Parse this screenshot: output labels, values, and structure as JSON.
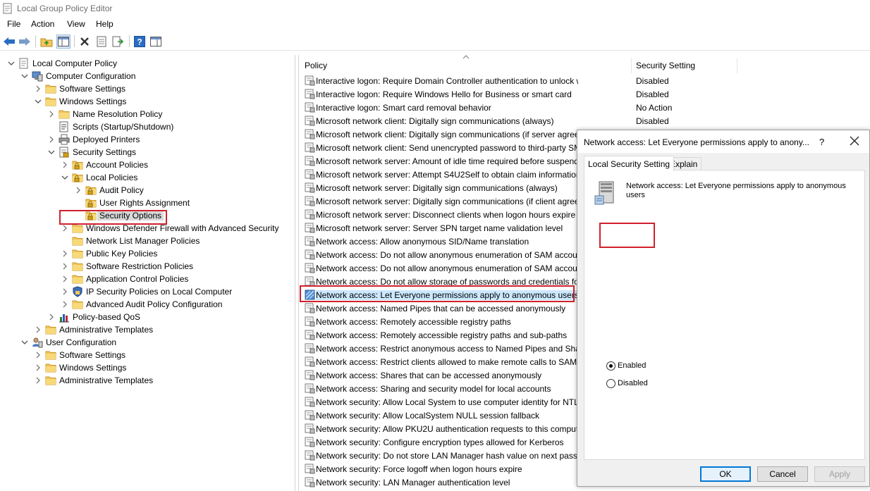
{
  "window": {
    "title": "Local Group Policy Editor"
  },
  "menu": [
    "File",
    "Action",
    "View",
    "Help"
  ],
  "tree": [
    {
      "label": "Local Computer Policy",
      "icon": "policy-doc-icon",
      "expanded": true
    },
    {
      "label": "Computer Configuration",
      "icon": "computer-icon",
      "expanded": true
    },
    {
      "label": "Software Settings",
      "icon": "folder-icon",
      "expanded": false
    },
    {
      "label": "Windows Settings",
      "icon": "folder-icon",
      "expanded": true
    },
    {
      "label": "Name Resolution Policy",
      "icon": "folder-icon",
      "expanded": false
    },
    {
      "label": "Scripts (Startup/Shutdown)",
      "icon": "script-icon",
      "expanded": null
    },
    {
      "label": "Deployed Printers",
      "icon": "printer-icon",
      "expanded": false
    },
    {
      "label": "Security Settings",
      "icon": "security-settings-icon",
      "expanded": true
    },
    {
      "label": "Account Policies",
      "icon": "locked-folder-icon",
      "expanded": false
    },
    {
      "label": "Local Policies",
      "icon": "locked-folder-icon",
      "expanded": true
    },
    {
      "label": "Audit Policy",
      "icon": "locked-folder-icon",
      "expanded": false
    },
    {
      "label": "User Rights Assignment",
      "icon": "locked-folder-icon",
      "expanded": null
    },
    {
      "label": "Security Options",
      "icon": "locked-folder-icon",
      "expanded": null,
      "selected": true
    },
    {
      "label": "Windows Defender Firewall with Advanced Security",
      "icon": "folder-icon",
      "expanded": false
    },
    {
      "label": "Network List Manager Policies",
      "icon": "folder-icon",
      "expanded": null
    },
    {
      "label": "Public Key Policies",
      "icon": "folder-icon",
      "expanded": false
    },
    {
      "label": "Software Restriction Policies",
      "icon": "folder-icon",
      "expanded": false
    },
    {
      "label": "Application Control Policies",
      "icon": "folder-icon",
      "expanded": false
    },
    {
      "label": "IP Security Policies on Local Computer",
      "icon": "ip-security-icon",
      "expanded": false
    },
    {
      "label": "Advanced Audit Policy Configuration",
      "icon": "folder-icon",
      "expanded": false
    },
    {
      "label": "Policy-based QoS",
      "icon": "qos-chart-icon",
      "expanded": false
    },
    {
      "label": "Administrative Templates",
      "icon": "folder-icon",
      "expanded": false
    },
    {
      "label": "User Configuration",
      "icon": "user-icon",
      "expanded": true
    },
    {
      "label": "Software Settings",
      "icon": "folder-icon",
      "expanded": false
    },
    {
      "label": "Windows Settings",
      "icon": "folder-icon",
      "expanded": false
    },
    {
      "label": "Administrative Templates",
      "icon": "folder-icon",
      "expanded": false
    }
  ],
  "list": {
    "columns": {
      "policy": "Policy",
      "setting": "Security Setting"
    },
    "rows": [
      {
        "policy": "Interactive logon: Require Domain Controller authentication to unlock workstation",
        "setting": "Disabled"
      },
      {
        "policy": "Interactive logon: Require Windows Hello for Business or smart card",
        "setting": "Disabled"
      },
      {
        "policy": "Interactive logon: Smart card removal behavior",
        "setting": "No Action"
      },
      {
        "policy": "Microsoft network client: Digitally sign communications (always)",
        "setting": "Disabled"
      },
      {
        "policy": "Microsoft network client: Digitally sign communications (if server agree",
        "setting": ""
      },
      {
        "policy": "Microsoft network client: Send unencrypted password to third-party SM",
        "setting": ""
      },
      {
        "policy": "Microsoft network server: Amount of idle time required before suspend",
        "setting": ""
      },
      {
        "policy": "Microsoft network server: Attempt S4U2Self to obtain claim information",
        "setting": ""
      },
      {
        "policy": "Microsoft network server: Digitally sign communications (always)",
        "setting": ""
      },
      {
        "policy": "Microsoft network server: Digitally sign communications (if client agree",
        "setting": ""
      },
      {
        "policy": "Microsoft network server: Disconnect clients when logon hours expire",
        "setting": ""
      },
      {
        "policy": "Microsoft network server: Server SPN target name validation level",
        "setting": ""
      },
      {
        "policy": "Network access: Allow anonymous SID/Name translation",
        "setting": ""
      },
      {
        "policy": "Network access: Do not allow anonymous enumeration of SAM accoun",
        "setting": ""
      },
      {
        "policy": "Network access: Do not allow anonymous enumeration of SAM accoun",
        "setting": ""
      },
      {
        "policy": "Network access: Do not allow storage of passwords and credentials for",
        "setting": ""
      },
      {
        "policy": "Network access: Let Everyone permissions apply to anonymous users",
        "setting": "",
        "selected": true
      },
      {
        "policy": "Network access: Named Pipes that can be accessed anonymously",
        "setting": ""
      },
      {
        "policy": "Network access: Remotely accessible registry paths",
        "setting": ""
      },
      {
        "policy": "Network access: Remotely accessible registry paths and sub-paths",
        "setting": ""
      },
      {
        "policy": "Network access: Restrict anonymous access to Named Pipes and Share",
        "setting": ""
      },
      {
        "policy": "Network access: Restrict clients allowed to make remote calls to SAM",
        "setting": ""
      },
      {
        "policy": "Network access: Shares that can be accessed anonymously",
        "setting": ""
      },
      {
        "policy": "Network access: Sharing and security model for local accounts",
        "setting": ""
      },
      {
        "policy": "Network security: Allow Local System to use computer identity for NTL",
        "setting": ""
      },
      {
        "policy": "Network security: Allow LocalSystem NULL session fallback",
        "setting": ""
      },
      {
        "policy": "Network security: Allow PKU2U authentication requests to this comput",
        "setting": ""
      },
      {
        "policy": "Network security: Configure encryption types allowed for Kerberos",
        "setting": ""
      },
      {
        "policy": "Network security: Do not store LAN Manager hash value on next passw",
        "setting": ""
      },
      {
        "policy": "Network security: Force logoff when logon hours expire",
        "setting": ""
      },
      {
        "policy": "Network security: LAN Manager authentication level",
        "setting": ""
      }
    ]
  },
  "dialog": {
    "title": "Network access: Let Everyone permissions apply to anony...",
    "help": "?",
    "tabs": [
      "Local Security Setting",
      "Explain"
    ],
    "policy_name": "Network access: Let Everyone permissions apply to anonymous users",
    "options": [
      {
        "label": "Enabled",
        "checked": true
      },
      {
        "label": "Disabled",
        "checked": false
      }
    ],
    "buttons": {
      "ok": "OK",
      "cancel": "Cancel",
      "apply": "Apply"
    }
  },
  "colors": {
    "highlight_box": "#d0202c",
    "selection": "#cce8ff",
    "folder": "#f3c55b",
    "toolbar_blue": "#2a6cc4"
  }
}
